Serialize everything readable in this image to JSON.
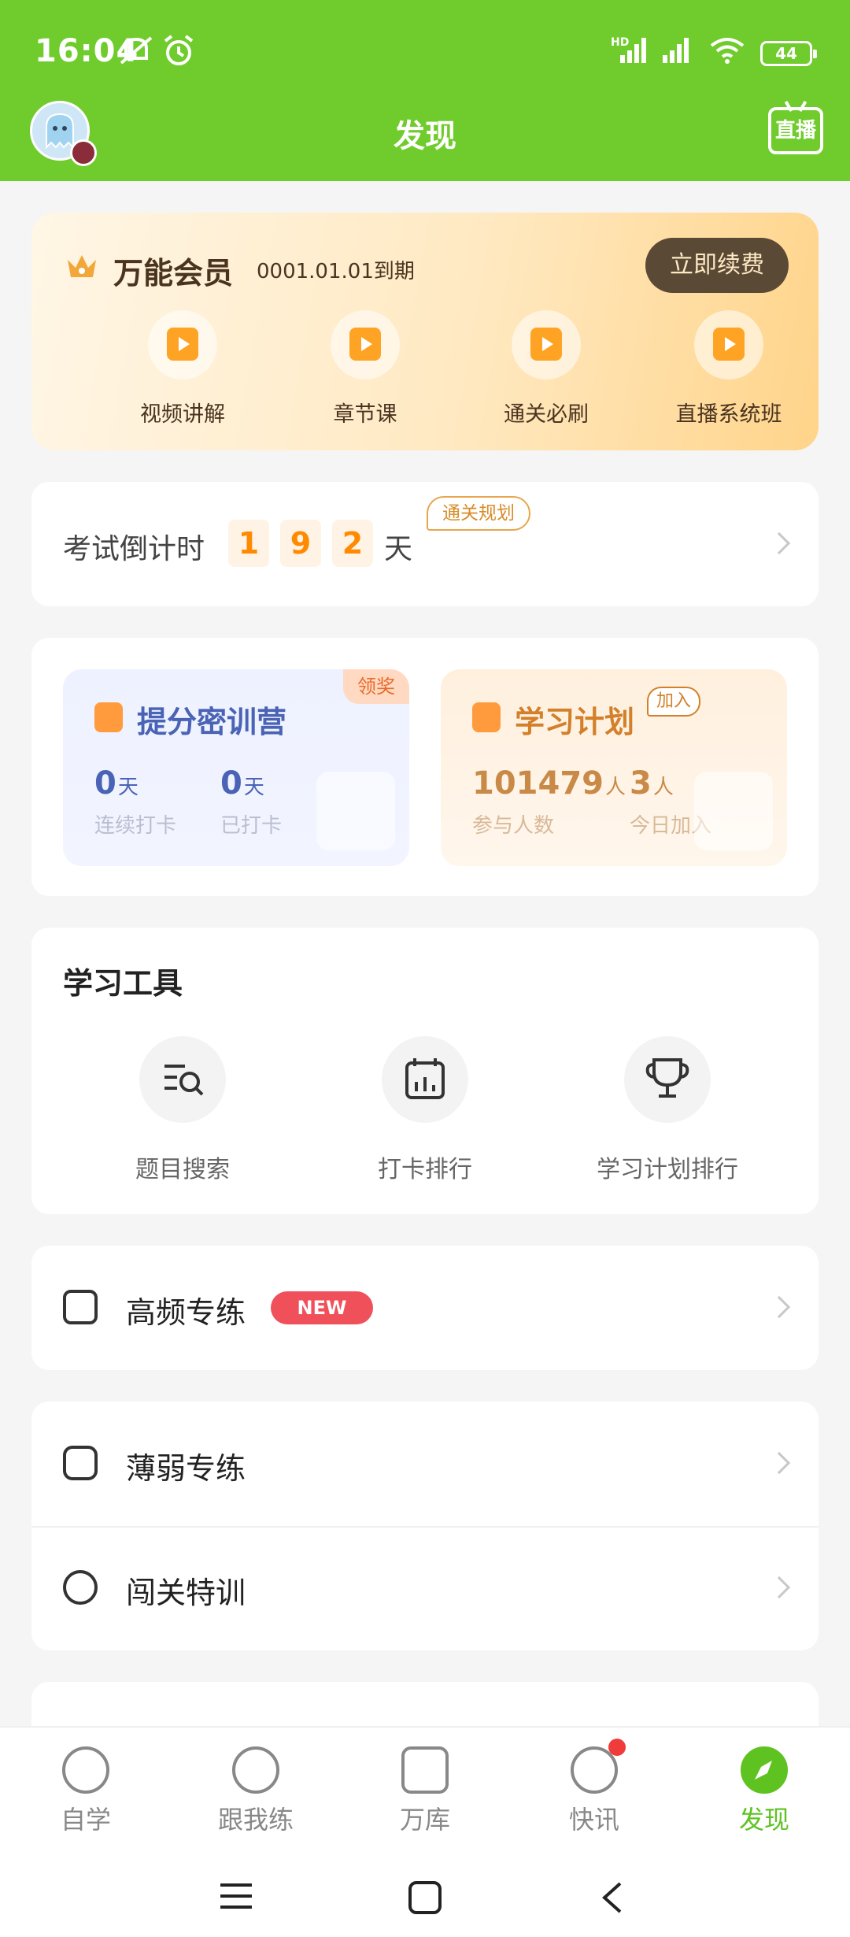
{
  "status_bar": {
    "time": "16:04",
    "battery": "44",
    "network": "HD"
  },
  "header": {
    "title": "发现",
    "live_button": "直播",
    "avatar_icon": "ghost-avatar"
  },
  "vip": {
    "title": "万能会员",
    "expire": "0001.01.01到期",
    "renew_button": "立即续费",
    "items": [
      {
        "label": "视频讲解",
        "icon": "video-icon"
      },
      {
        "label": "章节课",
        "icon": "chapter-icon"
      },
      {
        "label": "通关必刷",
        "icon": "checklist-icon"
      },
      {
        "label": "直播系统班",
        "icon": "live-class-icon"
      }
    ]
  },
  "countdown": {
    "label": "考试倒计时",
    "digits": [
      "1",
      "9",
      "2"
    ],
    "unit": "天",
    "tag": "通关规划"
  },
  "camp": {
    "title": "提分密训营",
    "tag": "领奖",
    "stats": [
      {
        "value": "0",
        "unit": "天",
        "caption": "连续打卡"
      },
      {
        "value": "0",
        "unit": "天",
        "caption": "已打卡"
      }
    ]
  },
  "plan": {
    "title": "学习计划",
    "tag": "加入",
    "stats": [
      {
        "value": "101479",
        "unit": "人",
        "caption": "参与人数"
      },
      {
        "value": "3",
        "unit": "人",
        "caption": "今日加入"
      }
    ]
  },
  "tools": {
    "title": "学习工具",
    "items": [
      {
        "label": "题目搜索",
        "icon": "search-list-icon"
      },
      {
        "label": "打卡排行",
        "icon": "calendar-chart-icon"
      },
      {
        "label": "学习计划排行",
        "icon": "trophy-icon"
      }
    ]
  },
  "rows": {
    "high_freq": {
      "label": "高频专练",
      "badge": "NEW"
    },
    "weak": {
      "label": "薄弱专练"
    },
    "challenge": {
      "label": "闯关特训"
    }
  },
  "tabs": [
    {
      "label": "自学"
    },
    {
      "label": "跟我练"
    },
    {
      "label": "万库"
    },
    {
      "label": "快讯"
    },
    {
      "label": "发现"
    }
  ],
  "colors": {
    "brand_green": "#6fcc2c",
    "active_tab": "#5ec321",
    "accent_orange": "#ff8a00",
    "badge_red": "#f0505a"
  }
}
